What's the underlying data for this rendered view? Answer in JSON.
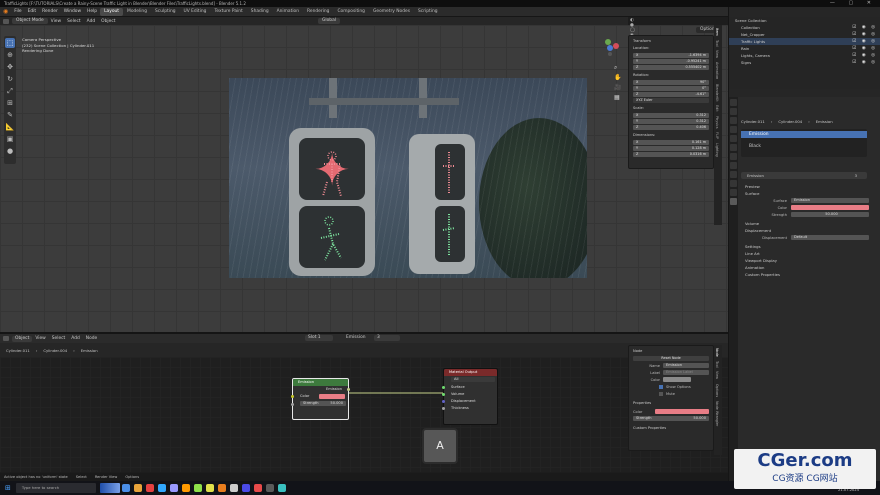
{
  "titlebar": {
    "text": "TrafficLights [F:\\TUTORIALS\\Create a Rainy-Scene Traffic Light in Blender\\Blender Files\\TrafficLights.blend] - Blender 5.1.2",
    "controls": "— ▢ ✕"
  },
  "menu": {
    "items": [
      "File",
      "Edit",
      "Render",
      "Window",
      "Help"
    ]
  },
  "workspaces": {
    "items": [
      "Layout",
      "Modeling",
      "Sculpting",
      "UV Editing",
      "Texture Paint",
      "Shading",
      "Animation",
      "Rendering",
      "Compositing",
      "Geometry Nodes",
      "Scripting"
    ],
    "active": "Layout"
  },
  "top_right": {
    "scene_label": "Scene",
    "viewlayer_label": "ViewLayer"
  },
  "viewport_header": {
    "mode": "Object Mode",
    "menus": [
      "View",
      "Select",
      "Add",
      "Object"
    ],
    "transform": "Global",
    "options": "Options"
  },
  "camera_text": {
    "line1": "Camera Perspective",
    "line2": "(232) Scene Collection | Cylinder.011",
    "line3": "Rendering Done"
  },
  "transform_panel": {
    "title": "Transform",
    "location_label": "Location:",
    "location": [
      {
        "axis": "X",
        "value": "-1.6394 m"
      },
      {
        "axis": "Y",
        "value": "-0.95241 m"
      },
      {
        "axis": "Z",
        "value": "0.555402 m"
      }
    ],
    "rotation_label": "Rotation:",
    "rotation": [
      {
        "axis": "X",
        "value": "90°"
      },
      {
        "axis": "Y",
        "value": "0°"
      },
      {
        "axis": "Z",
        "value": "-4.61°"
      }
    ],
    "rotation_mode": "XYZ Euler",
    "scale_label": "Scale:",
    "scale": [
      {
        "axis": "X",
        "value": "0.312"
      },
      {
        "axis": "Y",
        "value": "0.312"
      },
      {
        "axis": "Z",
        "value": "0.406"
      }
    ],
    "dimensions_label": "Dimensions:",
    "dimensions": [
      {
        "axis": "X",
        "value": "0.161 m"
      },
      {
        "axis": "Y",
        "value": "0.128 m"
      },
      {
        "axis": "Z",
        "value": "0.0316 m"
      }
    ]
  },
  "n_tabs": [
    "Item",
    "Tool",
    "View",
    "Animation",
    "BlenderKit",
    "Edit",
    "Physics",
    "FLIP",
    "Lighting"
  ],
  "outliner": {
    "header": "Scene Collection",
    "rows": [
      "Collection",
      "Net_Cropper",
      "Traffic Lights",
      "Rain",
      "Lights, Camera",
      "Signs"
    ]
  },
  "properties": {
    "breadcrumb": [
      "Cylinder.011",
      "Cylinder.004",
      "Emission"
    ],
    "material_slots": [
      "Emission",
      "Black"
    ],
    "material_name": "Emission",
    "user_count": "3",
    "sections": {
      "preview": "Preview",
      "surface": "Surface",
      "volume": "Volume",
      "displacement": "Displacement",
      "settings": "Settings",
      "line_art": "Line Art",
      "viewport_display": "Viewport Display",
      "animation": "Animation",
      "custom_properties": "Custom Properties"
    },
    "surface_label": "Surface",
    "surface_value": "Emission",
    "color_label": "Color",
    "strength_label": "Strength",
    "strength_value": "50.000",
    "displacement_label": "Displacement",
    "displacement_value": "Default",
    "emission_color": "#e87d86"
  },
  "node_header": {
    "editor": "Object",
    "menus": [
      "View",
      "Select",
      "Add",
      "Node"
    ],
    "slot": "Slot 1",
    "material": "Emission",
    "users": "3"
  },
  "node_breadcrumb": [
    "Cylinder.011",
    "Cylinder.004",
    "Emission"
  ],
  "nodes": {
    "emission": {
      "title": "Emission",
      "output": "Emission",
      "color_label": "Color",
      "strength_label": "Strength",
      "strength_value": "50.000"
    },
    "output": {
      "title": "Material Output",
      "target": "All",
      "inputs": [
        "Surface",
        "Volume",
        "Displacement",
        "Thickness"
      ]
    }
  },
  "node_panel": {
    "title": "Node",
    "reset": "Reset Node",
    "name_label": "Name",
    "name_value": "Emission",
    "label_label": "Label",
    "label_value": "Emission Label",
    "color_label": "Color",
    "show_options": "Show Options",
    "mute": "Mute",
    "properties_title": "Properties",
    "p_color_label": "Color",
    "p_strength_label": "Strength",
    "p_strength_value": "50.000",
    "custom_props": "Custom Properties"
  },
  "node_tabs": [
    "Node",
    "Tool",
    "View",
    "Options",
    "Node Wrangler"
  ],
  "keycast": "A",
  "status": {
    "left": "Active object has no 'uniform' state",
    "mid": "Select",
    "mid2": "Render View",
    "right": "Options"
  },
  "taskbar": {
    "search": "Type here to search",
    "time": "10:57",
    "date": "21-07-2024"
  },
  "watermark": {
    "line1": "CGer.com",
    "line2": "CG资源 CG网站"
  }
}
